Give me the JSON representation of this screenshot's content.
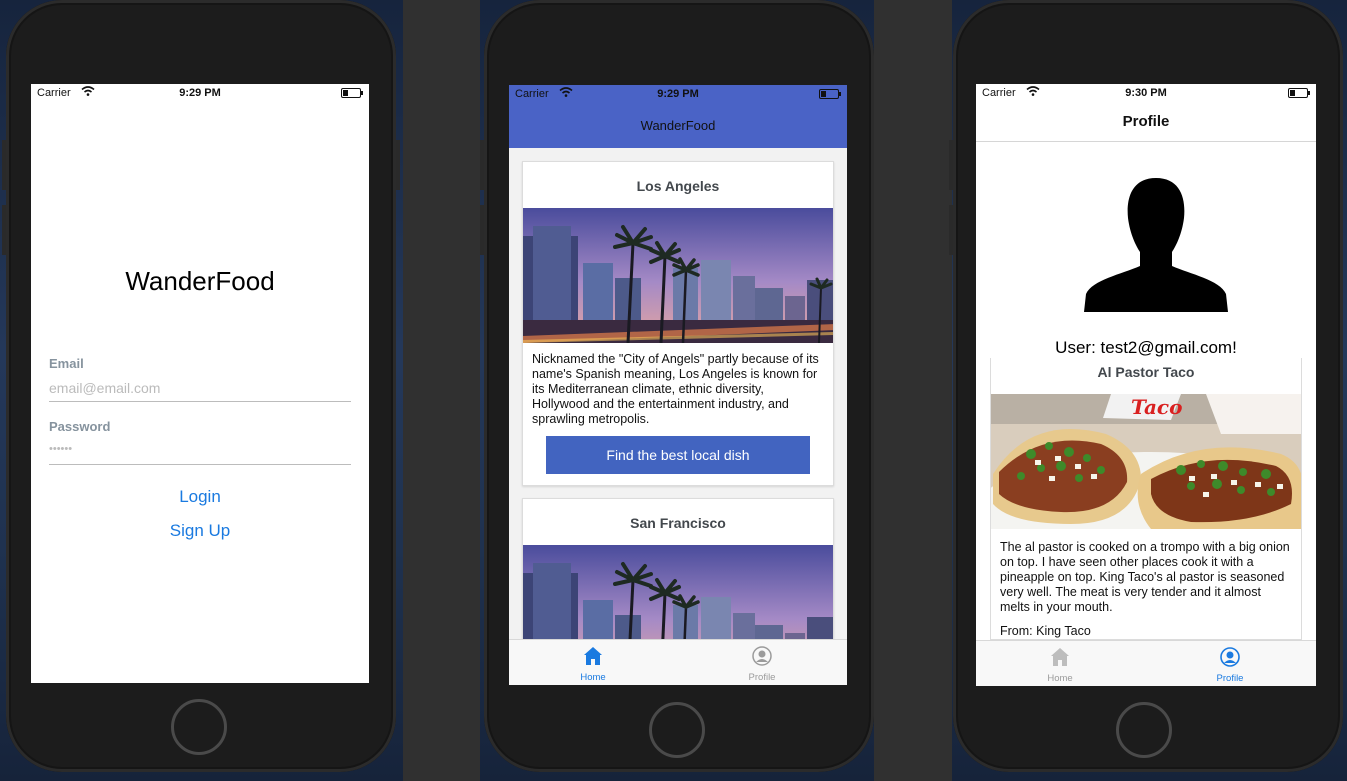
{
  "phones": {
    "login": {
      "status": {
        "carrier": "Carrier",
        "time": "9:29 PM"
      },
      "title": "WanderFood",
      "email_label": "Email",
      "email_placeholder": "email@email.com",
      "password_label": "Password",
      "password_value": "••••••",
      "login_label": "Login",
      "signup_label": "Sign Up"
    },
    "home": {
      "status": {
        "carrier": "Carrier",
        "time": "9:29 PM"
      },
      "nav_title": "WanderFood",
      "cards": [
        {
          "title": "Los Angeles",
          "description": "Nicknamed the \"City of Angels\" partly because of its name's Spanish meaning, Los Angeles is known for its Mediterranean climate, ethnic diversity, Hollywood and the entertainment industry, and sprawling metropolis.",
          "button_label": "Find the best local dish"
        },
        {
          "title": "San Francisco"
        }
      ],
      "tabs": [
        {
          "label": "Home",
          "icon": "home-icon",
          "active": true
        },
        {
          "label": "Profile",
          "icon": "profile-icon",
          "active": false
        }
      ]
    },
    "profile": {
      "status": {
        "carrier": "Carrier",
        "time": "9:30 PM"
      },
      "header_title": "Profile",
      "user_line": "User: test2@gmail.com!",
      "dish": {
        "title": "Al Pastor Taco",
        "sign_text": "Taco",
        "description": "The al pastor is cooked on a trompo with a big onion on top.  I have seen other places cook it with a pineapple on top.  King Taco's al pastor is seasoned very well.  The meat is very tender and it almost melts in your mouth.",
        "from": "From: King Taco"
      },
      "tabs": [
        {
          "label": "Home",
          "icon": "home-icon",
          "active": false
        },
        {
          "label": "Profile",
          "icon": "profile-icon",
          "active": true
        }
      ]
    }
  },
  "colors": {
    "accent_blue": "#4a63c6",
    "button_blue": "#4264c0",
    "link_blue": "#1a7ae0",
    "tab_active": "#1a7ae0",
    "tab_inactive": "#9b9b9b"
  }
}
